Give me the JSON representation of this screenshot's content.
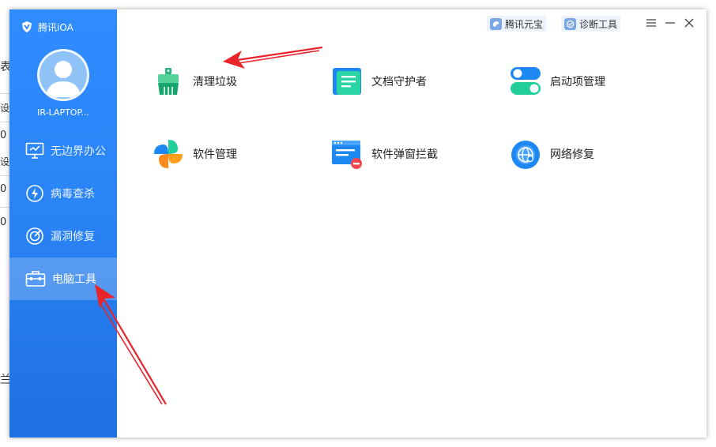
{
  "background_window": {
    "fragments": [
      "表",
      "设",
      "0",
      "设",
      "0",
      "0",
      "兰"
    ]
  },
  "app": {
    "title": "腾讯iOA",
    "user": {
      "name": "IR-LAPTOP..."
    },
    "sidebar": {
      "items": [
        {
          "label": "无边界办公",
          "icon": "monitor-icon",
          "active": false
        },
        {
          "label": "病毒查杀",
          "icon": "shield-bolt-icon",
          "active": false
        },
        {
          "label": "漏洞修复",
          "icon": "target-icon",
          "active": false
        },
        {
          "label": "电脑工具",
          "icon": "toolbox-icon",
          "active": true
        }
      ]
    },
    "topbar": {
      "buttons": [
        {
          "label": "腾讯元宝",
          "icon": "yuanbao-icon"
        },
        {
          "label": "诊断工具",
          "icon": "diagnose-icon"
        }
      ]
    },
    "tools": [
      {
        "label": "清理垃圾",
        "icon": "broom-icon"
      },
      {
        "label": "文档守护者",
        "icon": "document-icon"
      },
      {
        "label": "启动项管理",
        "icon": "toggle-icon"
      },
      {
        "label": "软件管理",
        "icon": "clover-icon"
      },
      {
        "label": "软件弹窗拦截",
        "icon": "popup-block-icon"
      },
      {
        "label": "网络修复",
        "icon": "globe-icon"
      }
    ],
    "colors": {
      "sidebar": "#2a84f6",
      "annotation_arrow": "#e8242a"
    }
  }
}
